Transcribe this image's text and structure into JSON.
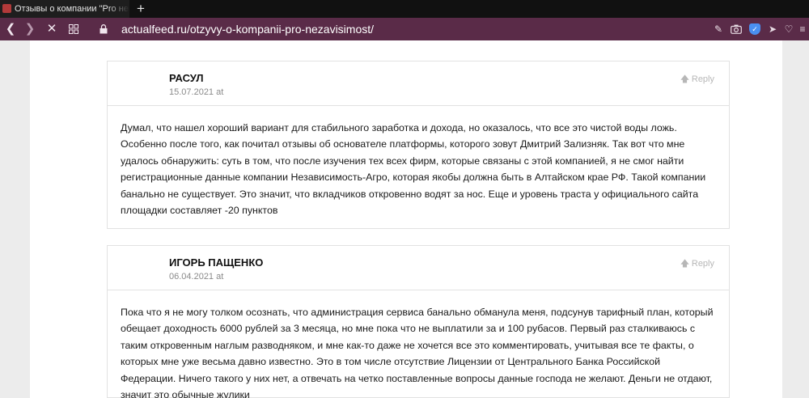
{
  "browser": {
    "tab_title": "Отзывы о компании \"Pro неза",
    "new_tab_icon": "plus-icon",
    "url": "actualfeed.ru/otzyvy-o-kompanii-pro-nezavisimost/",
    "colors": {
      "tab_strip": "#111111",
      "address_bar": "#5a2b48"
    }
  },
  "comments": [
    {
      "author": "РАСУЛ",
      "date": "15.07.2021 at",
      "reply_label": "Reply",
      "text": "Думал, что нашел хороший вариант для стабильного заработка и дохода, но оказалось, что все это чистой воды ложь. Особенно после того, как почитал отзывы об основателе платформы, которого зовут Дмитрий Зализняк. Так вот что мне удалось обнаружить: суть в том, что после изучения тех всех фирм, которые связаны с этой компанией, я не смог найти регистрационные данные компании Независимость-Агро, которая якобы должна быть в Алтайском крае РФ. Такой компании банально не существует. Это значит, что вкладчиков откровенно водят за нос. Еще и уровень траста у официального сайта площадки составляет -20 пунктов"
    },
    {
      "author": "ИГОРЬ ПАЩЕНКО",
      "date": "06.04.2021 at",
      "reply_label": "Reply",
      "text": "Пока что я не могу толком осознать, что администрация сервиса банально обманула меня, подсунув тарифный план, который обещает доходность 6000 рублей за 3 месяца, но мне пока что не выплатили за и 100 рубасов. Первый раз сталкиваюсь с таким откровенным наглым разводняком, и мне как-то даже не хочется все это комментировать, учитывая все те факты, о которых мне уже весьма давно известно. Это в том числе отсутствие Лицензии от Центрального Банка Российской Федерации. Ничего такого у них нет, а отвечать на четко поставленные вопросы данные господа не желают. Деньги не отдают, значит это обычные жулики"
    }
  ]
}
